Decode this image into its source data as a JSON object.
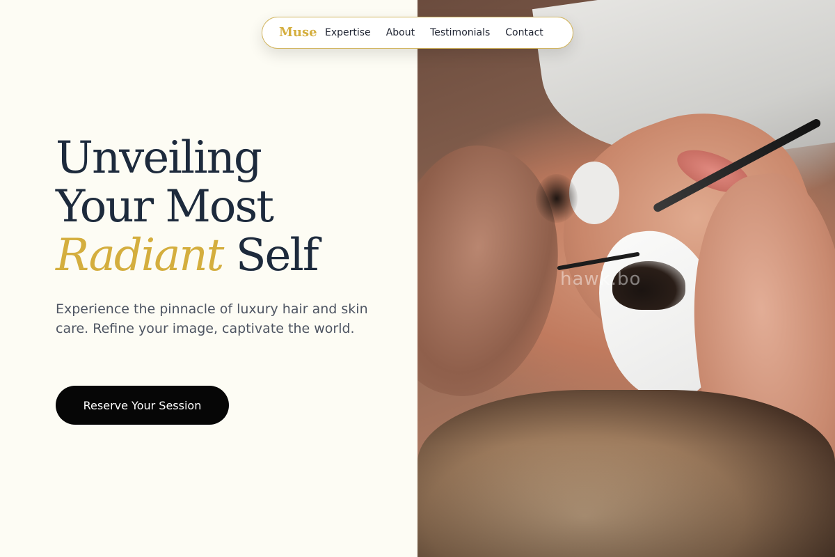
{
  "nav": {
    "logo": "Muse",
    "links": [
      "Expertise",
      "About",
      "Testimonials",
      "Contact"
    ]
  },
  "hero": {
    "title_line1": "Unveiling",
    "title_line2": "Your Most",
    "title_accent": "Radiant",
    "title_end": " Self",
    "subtitle": "Experience the pinnacle of luxury hair and skin care. Refine your image, captivate the world.",
    "cta_label": "Reserve Your Session"
  },
  "photo": {
    "alt": "Lash extension treatment close-up",
    "watermark": "hawk.bo"
  },
  "colors": {
    "accent": "#d4ae3e",
    "heading": "#1d2a3c",
    "body_text": "#4e5562",
    "background": "#fdfcf4",
    "cta_background": "#060606"
  }
}
